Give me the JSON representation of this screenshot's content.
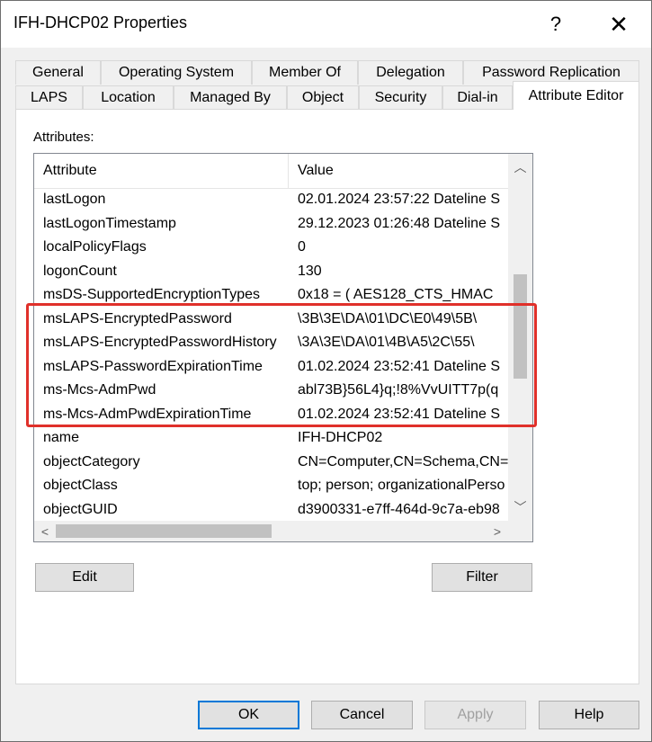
{
  "window": {
    "title": "IFH-DHCP02 Properties",
    "help_glyph": "?",
    "close_glyph": "✕"
  },
  "tabs_row1": [
    "General",
    "Operating System",
    "Member Of",
    "Delegation",
    "Password Replication"
  ],
  "tabs_row2": [
    "LAPS",
    "Location",
    "Managed By",
    "Object",
    "Security",
    "Dial-in",
    "Attribute Editor"
  ],
  "active_tab": "Attribute Editor",
  "attributes_label": "Attributes:",
  "list": {
    "columns": [
      "Attribute",
      "Value"
    ],
    "rows": [
      {
        "attribute": "lastLogon",
        "value": "02.01.2024 23:57:22 Dateline S"
      },
      {
        "attribute": "lastLogonTimestamp",
        "value": "29.12.2023 01:26:48 Dateline S"
      },
      {
        "attribute": "localPolicyFlags",
        "value": "0"
      },
      {
        "attribute": "logonCount",
        "value": "130"
      },
      {
        "attribute": "msDS-SupportedEncryptionTypes",
        "value": "0x18 = ( AES128_CTS_HMAC"
      },
      {
        "attribute": "msLAPS-EncryptedPassword",
        "value": "\\3B\\3E\\DA\\01\\DC\\E0\\49\\5B\\"
      },
      {
        "attribute": "msLAPS-EncryptedPasswordHistory",
        "value": "\\3A\\3E\\DA\\01\\4B\\A5\\2C\\55\\"
      },
      {
        "attribute": "msLAPS-PasswordExpirationTime",
        "value": "01.02.2024 23:52:41 Dateline S"
      },
      {
        "attribute": "ms-Mcs-AdmPwd",
        "value": "abl73B}56L4}q;!8%VvUITT7p(q"
      },
      {
        "attribute": "ms-Mcs-AdmPwdExpirationTime",
        "value": "01.02.2024 23:52:41 Dateline S"
      },
      {
        "attribute": "name",
        "value": "IFH-DHCP02"
      },
      {
        "attribute": "objectCategory",
        "value": "CN=Computer,CN=Schema,CN="
      },
      {
        "attribute": "objectClass",
        "value": "top; person; organizationalPerso"
      },
      {
        "attribute": "objectGUID",
        "value": "d3900331-e7ff-464d-9c7a-eb98"
      }
    ]
  },
  "buttons": {
    "edit": "Edit",
    "filter": "Filter",
    "ok": "OK",
    "cancel": "Cancel",
    "apply": "Apply",
    "help": "Help"
  },
  "highlight_color": "#e0302a",
  "accent_color": "#0078d7"
}
